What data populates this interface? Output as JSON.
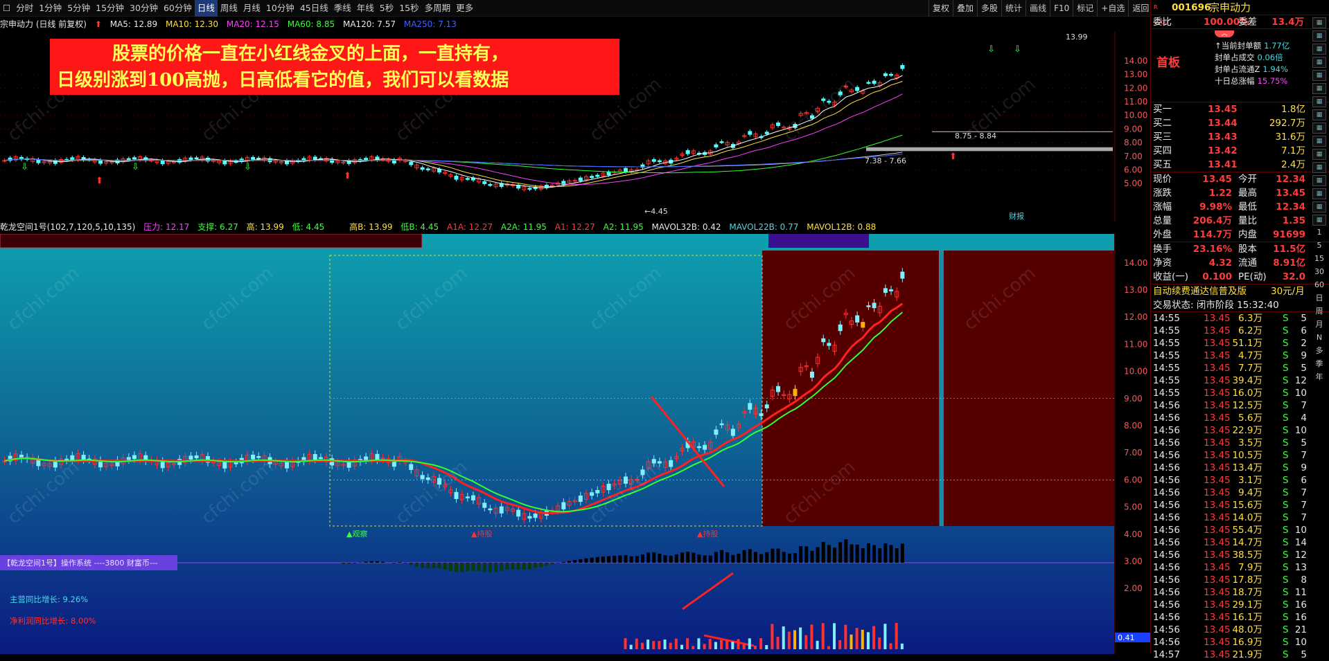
{
  "toolbar": {
    "items": [
      "分时",
      "1分钟",
      "5分钟",
      "15分钟",
      "30分钟",
      "60分钟",
      "日线",
      "周线",
      "月线",
      "10分钟",
      "45日线",
      "季线",
      "年线",
      "5秒",
      "15秒",
      "多周期",
      "更多"
    ],
    "selected": "日线",
    "right_items": [
      "复权",
      "叠加",
      "多股",
      "统计",
      "画线",
      "F10",
      "标记",
      "+自选",
      "返回"
    ]
  },
  "info": {
    "title": "宗申动力 (日线 前复权)",
    "ma5": "MA5: 12.89",
    "ma10": "MA10: 12.30",
    "ma20": "MA20: 12.15",
    "ma60": "MA60: 8.85",
    "ma120": "MA120: 7.57",
    "ma250": "MA250: 7.13"
  },
  "banner": {
    "line1": "股票的价格一直在小红线金叉的上面，一直持有，",
    "line2": "日级别涨到100高抛，日高低看它的值，我们可以看数据"
  },
  "main_chart": {
    "y_ticks": [
      "14.00",
      "13.00",
      "12.00",
      "11.00",
      "10.00",
      "9.00",
      "8.00",
      "7.00",
      "6.00",
      "5.00"
    ],
    "high_label": "13.99",
    "low_label": "4.45",
    "range1": "8.75 - 8.84",
    "range2": "7.38 - 7.66",
    "caibao": "财报"
  },
  "mid_bar": {
    "name": "乾龙空间1号(102,7,120,5,10,135)",
    "pressure": "压力: 12.17",
    "support": "支撑: 6.27",
    "high": "高: 13.99",
    "low": "低: 4.45",
    "highB": "高B: 13.99",
    "lowB": "低B: 4.45",
    "a1a": "A1A: 12.27",
    "a2a": "A2A: 11.95",
    "a1": "A1: 12.27",
    "a2": "A2: 11.95",
    "mavol32b": "MAVOL32B: 0.42",
    "mavol22b": "MAVOL22B: 0.77",
    "mavol12b": "MAVOL12B: 0.88"
  },
  "lower_chart": {
    "y_ticks": [
      "14.00",
      "13.00",
      "12.00",
      "11.00",
      "10.00",
      "9.00",
      "8.00",
      "7.00",
      "6.00",
      "5.00",
      "4.00",
      "3.00",
      "2.00"
    ],
    "label_watch": "▲观察",
    "label_hold1": "▲持股",
    "label_hold2": "▲持股",
    "system_label": "【乾龙空间1号】操作系统 ----3800 财富币---",
    "main_growth": "主营同比增长: 9.26%",
    "profit_growth": "净利润同比增长: 8.00%",
    "vol_value": "0.41"
  },
  "right_panel": {
    "code": "001696",
    "name": "宗申动力",
    "weibi_label": "委比",
    "weibi_value": "100.00%",
    "weicha_label": "委差",
    "weicha_value": "13.4万",
    "board": "首板",
    "seal_stats": [
      {
        "label": "↑当前封单额",
        "value": "1.77亿"
      },
      {
        "label": "封单占成交",
        "value": "0.06倍"
      },
      {
        "label": "封单占流通Z",
        "value": "1.94%"
      },
      {
        "label": "十日总涨幅",
        "value": "15.75%"
      }
    ],
    "bids": [
      {
        "label": "买一",
        "price": "13.45",
        "vol": "1.8亿"
      },
      {
        "label": "买二",
        "price": "13.44",
        "vol": "292.7万"
      },
      {
        "label": "买三",
        "price": "13.43",
        "vol": "31.6万"
      },
      {
        "label": "买四",
        "price": "13.42",
        "vol": "7.1万"
      },
      {
        "label": "买五",
        "price": "13.41",
        "vol": "2.4万"
      }
    ],
    "quote_rows": [
      {
        "l1": "现价",
        "v1": "13.45",
        "l2": "今开",
        "v2": "12.34"
      },
      {
        "l1": "涨跌",
        "v1": "1.22",
        "l2": "最高",
        "v2": "13.45"
      },
      {
        "l1": "涨幅",
        "v1": "9.98%",
        "l2": "最低",
        "v2": "12.34"
      },
      {
        "l1": "总量",
        "v1": "206.4万",
        "l2": "量比",
        "v2": "1.35"
      },
      {
        "l1": "外盘",
        "v1": "114.7万",
        "l2": "内盘",
        "v2": "91699"
      }
    ],
    "fund_rows": [
      {
        "l1": "换手",
        "v1": "23.16%",
        "l2": "股本",
        "v2": "11.5亿"
      },
      {
        "l1": "净资",
        "v1": "4.32",
        "l2": "流通",
        "v2": "8.91亿"
      },
      {
        "l1": "收益(一)",
        "v1": "0.100",
        "l2": "PE(动)",
        "v2": "32.0"
      }
    ],
    "promo": "自动续费通达信普及版",
    "promo_price": "30元/月",
    "trade_status": "交易状态: 闭市阶段 15:32:40",
    "ticks": [
      {
        "t": "14:55",
        "p": "13.45",
        "v": "6.3万",
        "s": "S",
        "n": "5"
      },
      {
        "t": "14:55",
        "p": "13.45",
        "v": "6.2万",
        "s": "S",
        "n": "6"
      },
      {
        "t": "14:55",
        "p": "13.45",
        "v": "51.1万",
        "s": "S",
        "n": "2"
      },
      {
        "t": "14:55",
        "p": "13.45",
        "v": "4.7万",
        "s": "S",
        "n": "9"
      },
      {
        "t": "14:55",
        "p": "13.45",
        "v": "7.7万",
        "s": "S",
        "n": "5"
      },
      {
        "t": "14:55",
        "p": "13.45",
        "v": "39.4万",
        "s": "S",
        "n": "12"
      },
      {
        "t": "14:55",
        "p": "13.45",
        "v": "16.0万",
        "s": "S",
        "n": "10"
      },
      {
        "t": "14:56",
        "p": "13.45",
        "v": "12.5万",
        "s": "S",
        "n": "7"
      },
      {
        "t": "14:56",
        "p": "13.45",
        "v": "5.6万",
        "s": "S",
        "n": "4"
      },
      {
        "t": "14:56",
        "p": "13.45",
        "v": "22.9万",
        "s": "S",
        "n": "10"
      },
      {
        "t": "14:56",
        "p": "13.45",
        "v": "3.5万",
        "s": "S",
        "n": "5"
      },
      {
        "t": "14:56",
        "p": "13.45",
        "v": "10.5万",
        "s": "S",
        "n": "7"
      },
      {
        "t": "14:56",
        "p": "13.45",
        "v": "13.4万",
        "s": "S",
        "n": "9"
      },
      {
        "t": "14:56",
        "p": "13.45",
        "v": "3.1万",
        "s": "S",
        "n": "6"
      },
      {
        "t": "14:56",
        "p": "13.45",
        "v": "9.4万",
        "s": "S",
        "n": "7"
      },
      {
        "t": "14:56",
        "p": "13.45",
        "v": "15.6万",
        "s": "S",
        "n": "7"
      },
      {
        "t": "14:56",
        "p": "13.45",
        "v": "14.0万",
        "s": "S",
        "n": "7"
      },
      {
        "t": "14:56",
        "p": "13.45",
        "v": "55.4万",
        "s": "S",
        "n": "10"
      },
      {
        "t": "14:56",
        "p": "13.45",
        "v": "14.7万",
        "s": "S",
        "n": "14"
      },
      {
        "t": "14:56",
        "p": "13.45",
        "v": "38.5万",
        "s": "S",
        "n": "12"
      },
      {
        "t": "14:56",
        "p": "13.45",
        "v": "7.9万",
        "s": "S",
        "n": "13"
      },
      {
        "t": "14:56",
        "p": "13.45",
        "v": "17.8万",
        "s": "S",
        "n": "8"
      },
      {
        "t": "14:56",
        "p": "13.45",
        "v": "18.7万",
        "s": "S",
        "n": "11"
      },
      {
        "t": "14:56",
        "p": "13.45",
        "v": "29.1万",
        "s": "S",
        "n": "16"
      },
      {
        "t": "14:56",
        "p": "13.45",
        "v": "16.1万",
        "s": "S",
        "n": "16"
      },
      {
        "t": "14:56",
        "p": "13.45",
        "v": "48.0万",
        "s": "S",
        "n": "21"
      },
      {
        "t": "14:56",
        "p": "13.45",
        "v": "16.9万",
        "s": "S",
        "n": "10"
      },
      {
        "t": "14:57",
        "p": "13.45",
        "v": "21.9万",
        "s": "S",
        "n": "5"
      }
    ],
    "side_tools": [
      "1",
      "5",
      "15",
      "30",
      "60",
      "日",
      "周",
      "月",
      "N",
      "多",
      "季",
      "年"
    ]
  },
  "watermark": "cfchi.com"
}
